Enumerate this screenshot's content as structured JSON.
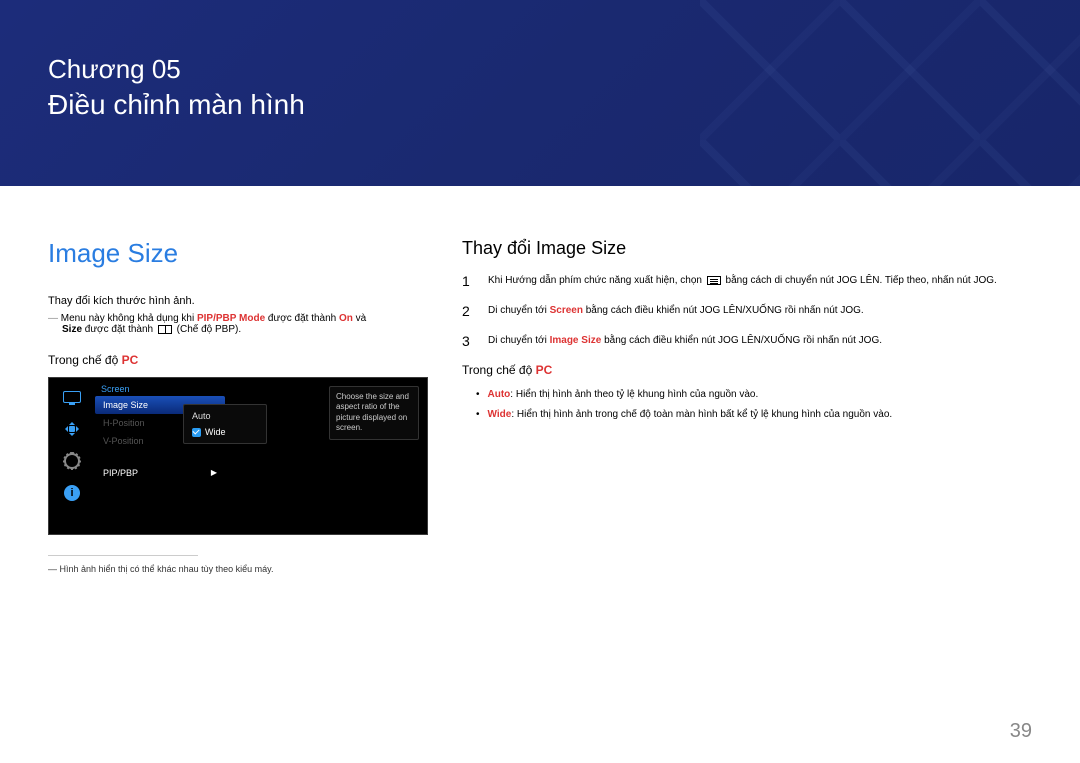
{
  "header": {
    "chapter_label": "Chương 05",
    "chapter_title": "Điều chỉnh màn hình"
  },
  "left": {
    "title": "Image Size",
    "descr": "Thay đổi kích thước hình ảnh.",
    "note_dash": "―",
    "note_pre": " Menu này không khả dụng khi ",
    "note_hl1": "PIP/PBP Mode",
    "note_mid": " được đặt thành ",
    "note_hl2": "On",
    "note_post": " và ",
    "note_hl3": "Size",
    "note_end1": " được đặt thành ",
    "note_end2": " (Chế độ PBP).",
    "mode_label_pre": "Trong chế độ ",
    "mode_label_accent": "PC",
    "osd": {
      "header": "Screen",
      "items": [
        {
          "label": "Image Size",
          "active": true
        },
        {
          "label": "H-Position",
          "active": false
        },
        {
          "label": "V-Position",
          "active": false
        },
        {
          "label": "PIP/PBP",
          "active": false,
          "arrow": "▶"
        }
      ],
      "submenu": [
        {
          "label": "Auto",
          "selected": false
        },
        {
          "label": "Wide",
          "selected": true
        }
      ],
      "help": "Choose the size and aspect ratio of the picture displayed on screen."
    },
    "footnote_dash": "―",
    "footnote": " Hình ảnh hiển thị có thể khác nhau tùy theo kiểu máy."
  },
  "right": {
    "title": "Thay đổi Image Size",
    "steps": [
      {
        "num": "1",
        "pre": "Khi Hướng dẫn phím chức năng xuất hiện, chọn ",
        "icon": true,
        "post": " bằng cách di chuyển nút JOG LÊN. Tiếp theo, nhấn nút JOG."
      },
      {
        "num": "2",
        "pre": "Di chuyển tới ",
        "hl": "Screen",
        "hlclass": "hl",
        "post": " bằng cách điều khiển nút JOG LÊN/XUỐNG rồi nhấn nút JOG."
      },
      {
        "num": "3",
        "pre": "Di chuyển tới ",
        "hl": "Image Size",
        "hlclass": "hl",
        "post": " bằng cách điều khiển nút JOG LÊN/XUỐNG rồi nhấn nút JOG."
      }
    ],
    "mode_label_pre": "Trong chế độ ",
    "mode_label_accent": "PC",
    "bullets": [
      {
        "hl": "Auto",
        "text": ": Hiển thị hình ảnh theo tỷ lệ khung hình của nguồn vào."
      },
      {
        "hl": "Wide",
        "text": ": Hiển thị hình ảnh trong chế độ toàn màn hình bất kể tỷ lệ khung hình của nguồn vào."
      }
    ]
  },
  "page_number": "39"
}
